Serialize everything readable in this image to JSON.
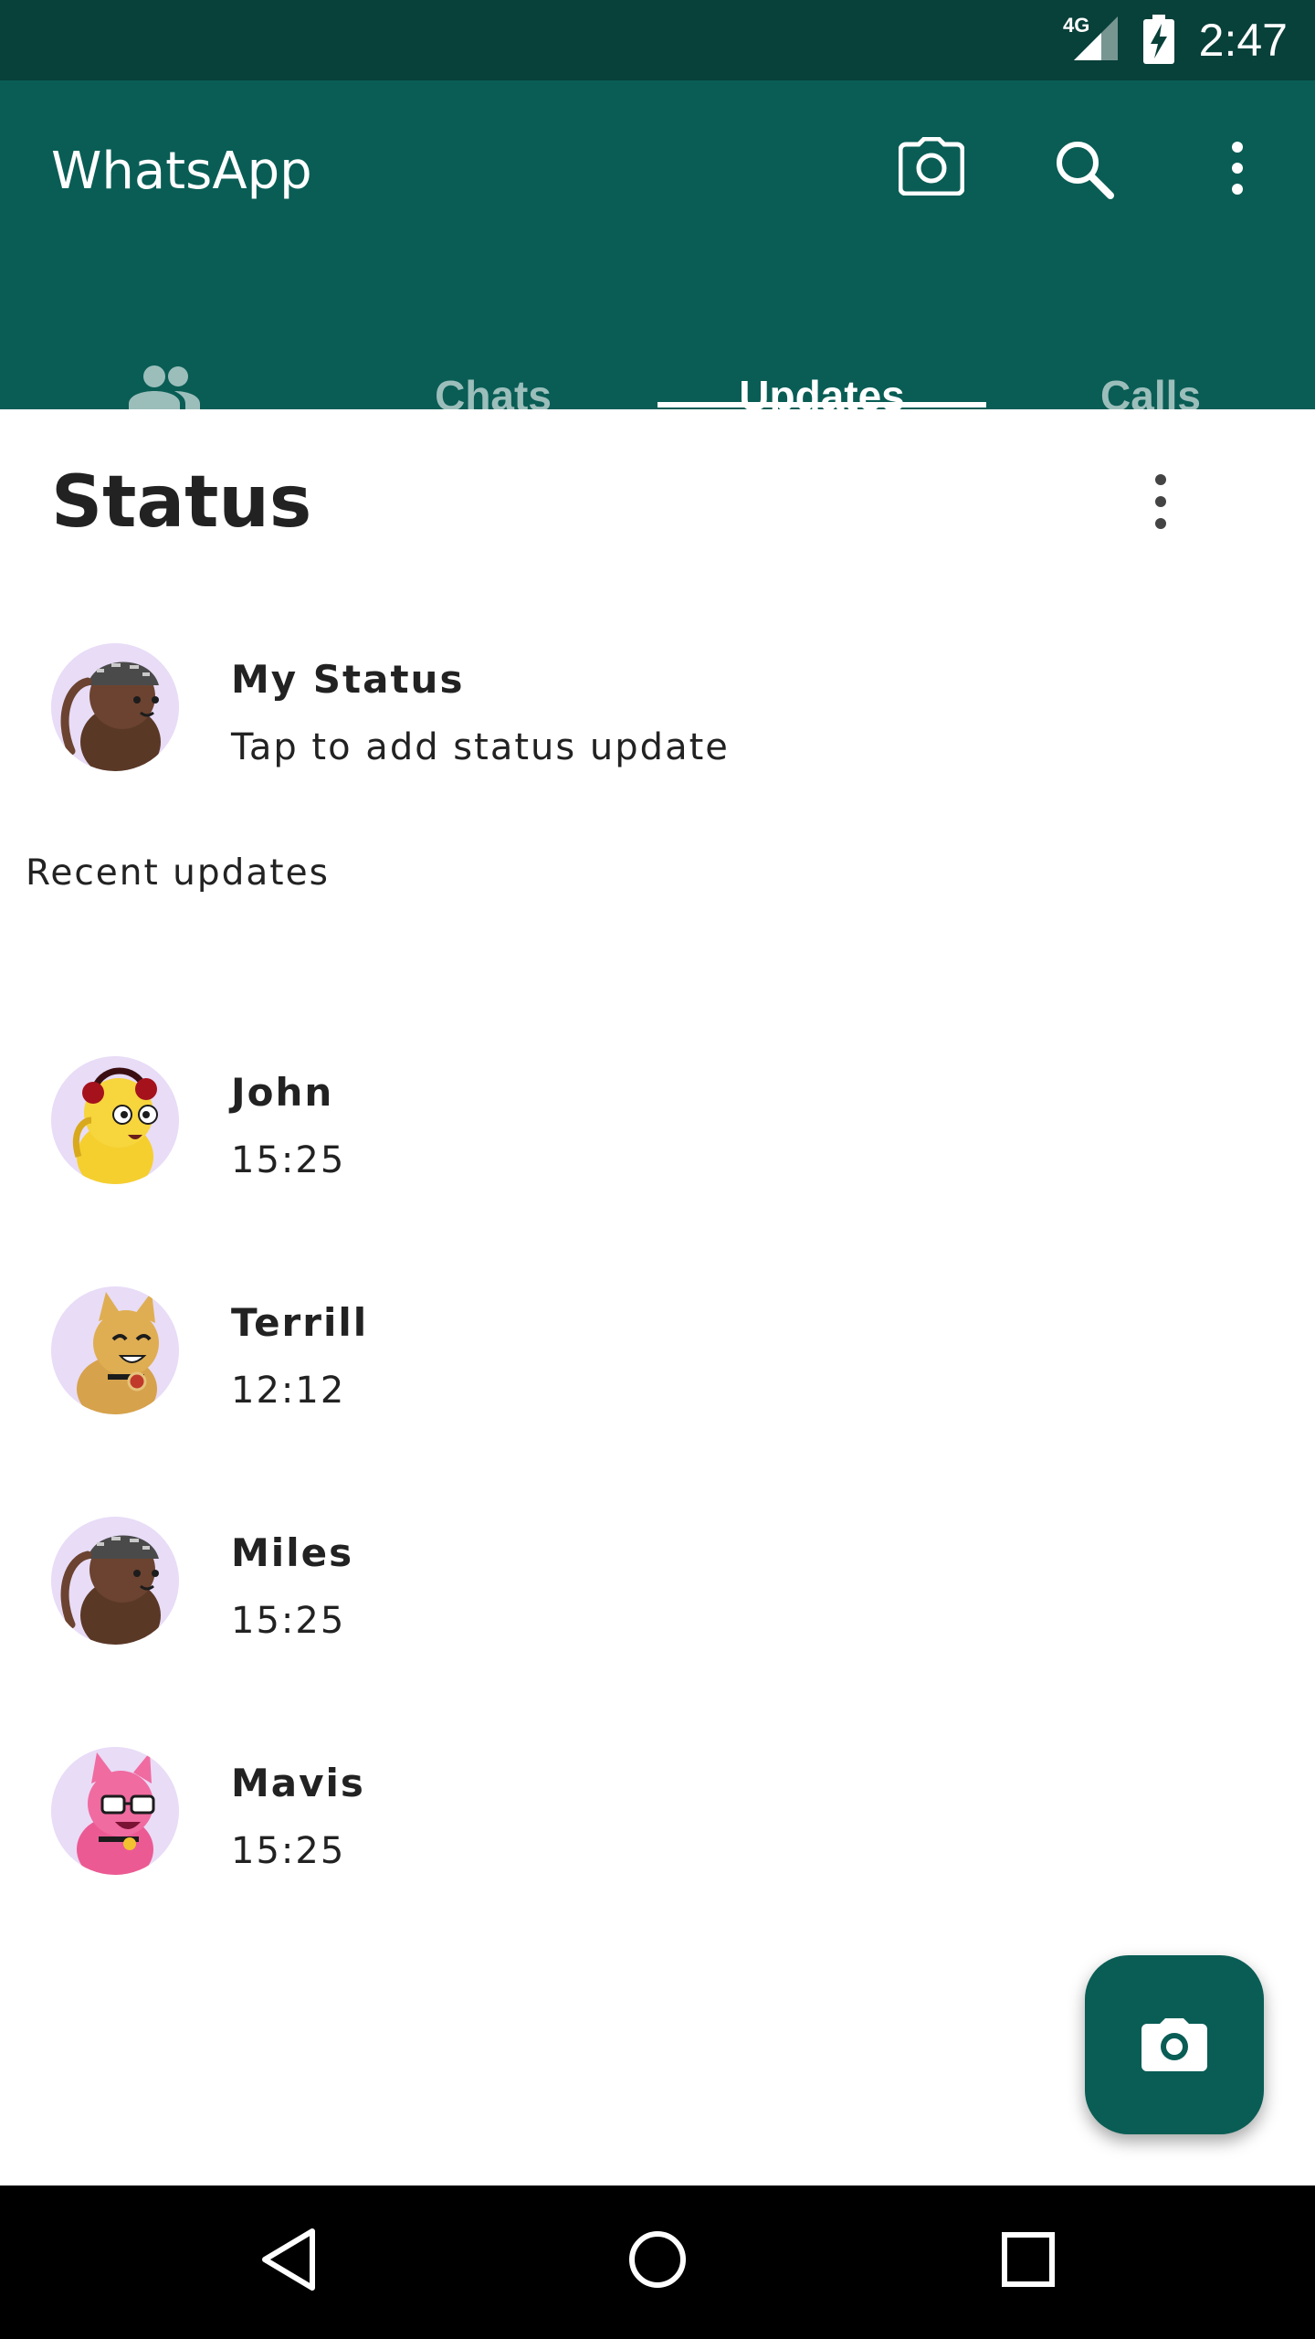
{
  "status_bar": {
    "network": "4G",
    "time": "2:47"
  },
  "app_bar": {
    "title": "WhatsApp",
    "icons": [
      "camera-icon",
      "search-icon",
      "more-vert-icon"
    ]
  },
  "tabs": [
    {
      "label": "",
      "icon": "community-icon"
    },
    {
      "label": "Chats"
    },
    {
      "label": "Updates",
      "active": true
    },
    {
      "label": "Calls"
    }
  ],
  "status_section": {
    "title": "Status",
    "my_status": {
      "name": "My Status",
      "subtitle": "Tap to add status update"
    },
    "recent_label": "Recent updates",
    "recent": [
      {
        "name": "John",
        "time": "15:25"
      },
      {
        "name": "Terrill",
        "time": "12:12"
      },
      {
        "name": "Miles",
        "time": "15:25"
      },
      {
        "name": "Mavis",
        "time": "15:25"
      }
    ]
  },
  "fab": {
    "icon": "camera-icon"
  },
  "nav_bar": {
    "icons": [
      "back-icon",
      "home-icon",
      "recents-icon"
    ]
  },
  "colors": {
    "status_bar_bg": "#08403a",
    "app_bar_bg": "#095d55",
    "text_primary": "#222222"
  }
}
